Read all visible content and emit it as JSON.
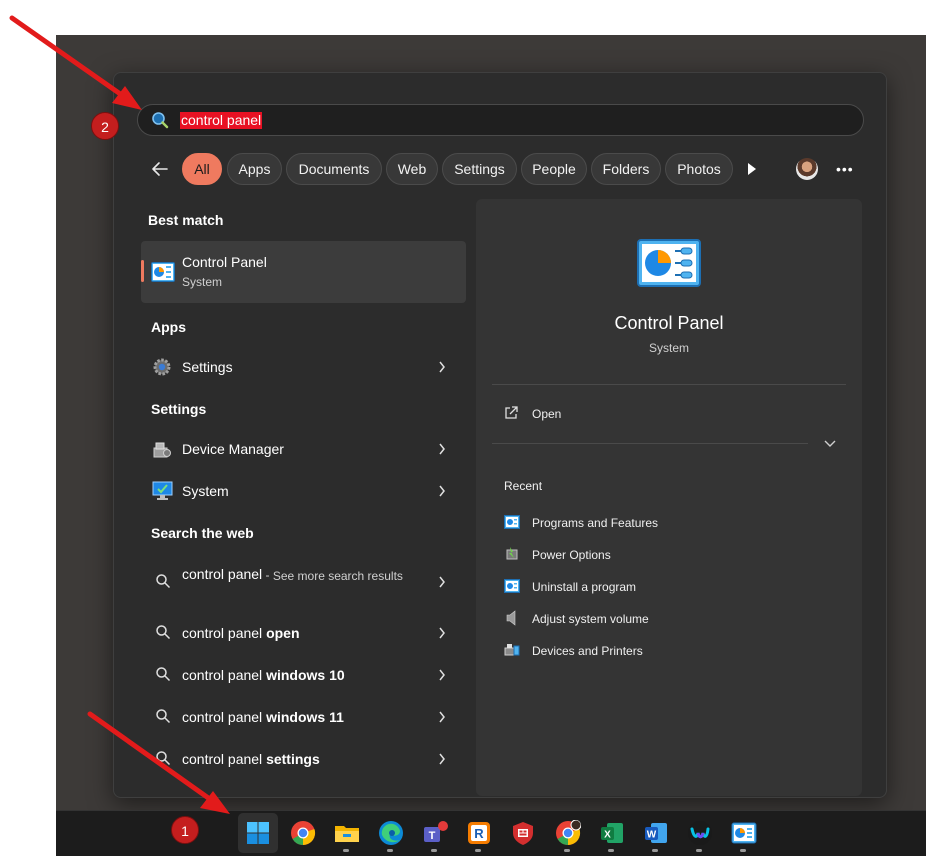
{
  "search": {
    "query": "control panel"
  },
  "filters": {
    "items": [
      "All",
      "Apps",
      "Documents",
      "Web",
      "Settings",
      "People",
      "Folders",
      "Photos"
    ],
    "active": "All"
  },
  "results": {
    "best_match_heading": "Best match",
    "best_match": {
      "title": "Control Panel",
      "subtitle": "System"
    },
    "apps_heading": "Apps",
    "apps": [
      {
        "label": "Settings"
      }
    ],
    "settings_heading": "Settings",
    "settings": [
      {
        "label": "Device Manager"
      },
      {
        "label": "System"
      }
    ],
    "web_heading": "Search the web",
    "web": [
      {
        "prefix": "control panel",
        "bold": "",
        "suffix": "See more search results"
      },
      {
        "prefix": "control panel ",
        "bold": "open"
      },
      {
        "prefix": "control panel ",
        "bold": "windows 10"
      },
      {
        "prefix": "control panel ",
        "bold": "windows 11"
      },
      {
        "prefix": "control panel ",
        "bold": "settings"
      }
    ]
  },
  "preview": {
    "title": "Control Panel",
    "subtitle": "System",
    "open_label": "Open",
    "recent_heading": "Recent",
    "recent": [
      "Programs and Features",
      "Power Options",
      "Uninstall a program",
      "Adjust system volume",
      "Devices and Printers"
    ]
  },
  "annotations": {
    "step1": "1",
    "step2": "2"
  },
  "taskbar": {
    "icons": [
      "windows-start-icon",
      "chrome-icon",
      "file-explorer-icon",
      "edge-icon",
      "teams-icon",
      "remote-icon",
      "shield-app-icon",
      "chrome-profile-icon",
      "excel-icon",
      "word-icon",
      "webex-icon",
      "control-panel-icon"
    ]
  },
  "colors": {
    "accent": "#ef7a5f",
    "highlight": "#e81123",
    "annotation_red": "#e21b1b"
  }
}
